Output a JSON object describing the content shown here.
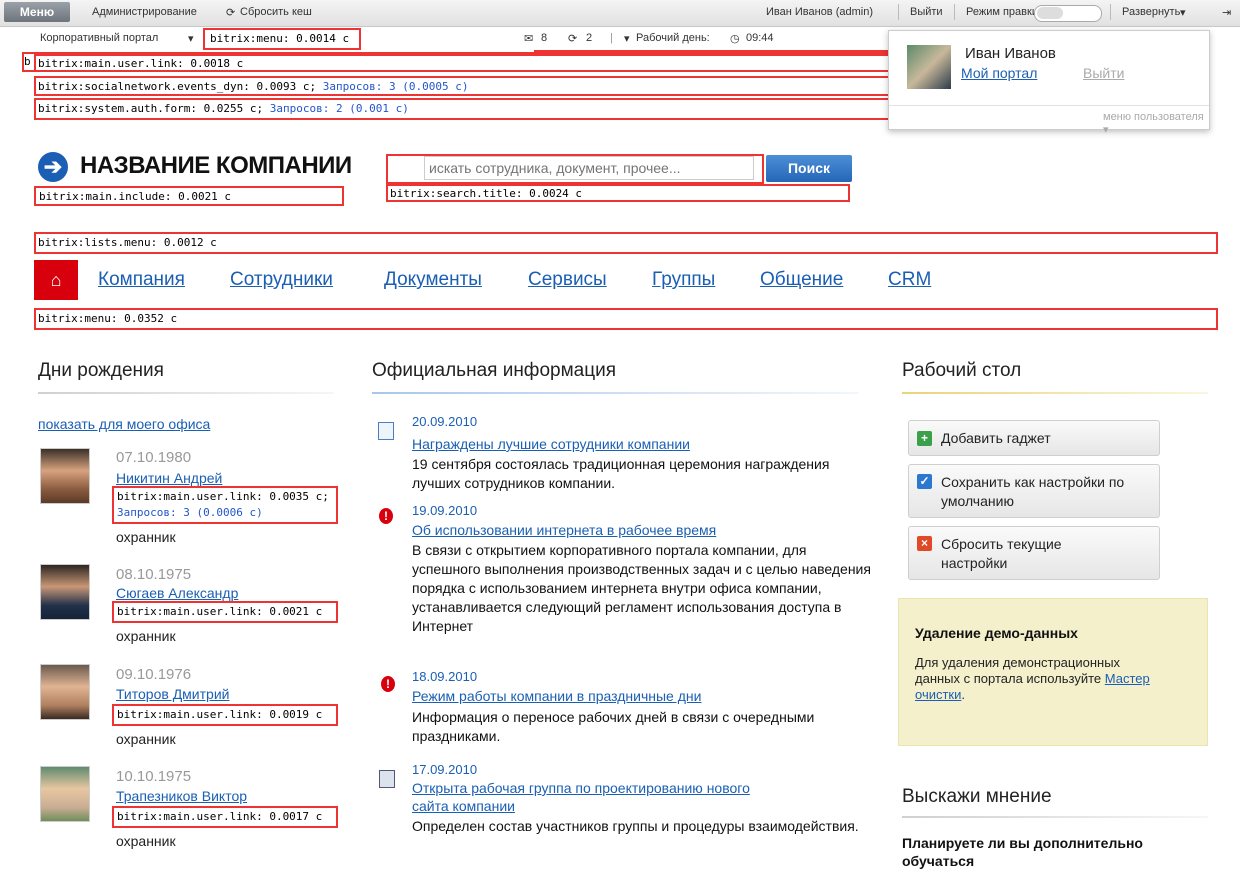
{
  "admin_bar": {
    "menu_button": "Меню",
    "administration": "Администрирование",
    "clear_cache": "Сбросить кеш",
    "user": "Иван Иванов (admin)",
    "logout": "Выйти",
    "edit_mode": "Режим правки",
    "expand": "Развернуть"
  },
  "sub_bar": {
    "portal": "Корпоративный портал",
    "messages_count": "8",
    "updates_count": "2",
    "workday_label": "Рабочий день:",
    "workday_time": "09:44"
  },
  "user_popup": {
    "name": "Иван Иванов",
    "my_portal": "Мой портал",
    "logout": "Выйти",
    "user_menu": "меню пользователя"
  },
  "debug": {
    "menu_top": "bitrix:menu: 0.0014 с",
    "user_link_top_prefix": "b",
    "user_link_top": "bitrix:main.user.link: 0.0018 с",
    "socnet": "bitrix:socialnetwork.events_dyn: 0.0093 с;",
    "socnet_q": "Запросов: 3 (0.0005 с)",
    "auth": "bitrix:system.auth.form: 0.0255 с;",
    "auth_q": "Запросов: 2 (0.001 с)",
    "include": "bitrix:main.include: 0.0021 с",
    "search": "bitrix:search.title: 0.0024 с",
    "lists_menu": "bitrix:lists.menu: 0.0012 с",
    "menu_bottom": "bitrix:menu: 0.0352 с",
    "ul1": "bitrix:main.user.link: 0.0035 с;",
    "ul1_q": "Запросов: 3 (0.0006 с)",
    "ul2": "bitrix:main.user.link: 0.0021 с",
    "ul3": "bitrix:main.user.link: 0.0019 с",
    "ul4": "bitrix:main.user.link: 0.0017 с"
  },
  "company": {
    "name": "НАЗВАНИЕ КОМПАНИИ"
  },
  "search": {
    "placeholder": "искать сотрудника, документ, прочее...",
    "button": "Поиск"
  },
  "nav": [
    "Компания",
    "Сотрудники",
    "Документы",
    "Сервисы",
    "Группы",
    "Общение",
    "CRM"
  ],
  "birthdays": {
    "title": "Дни рождения",
    "show_office": "показать для моего офиса",
    "people": [
      {
        "date": "07.10.1980",
        "name": "Никитин Андрей",
        "job": "охранник"
      },
      {
        "date": "08.10.1975",
        "name": "Сюгаев Александр",
        "job": "охранник"
      },
      {
        "date": "09.10.1976",
        "name": "Титоров Дмитрий",
        "job": "охранник"
      },
      {
        "date": "10.10.1975",
        "name": "Трапезников Виктор",
        "job": "охранник"
      }
    ]
  },
  "news": {
    "title": "Официальная информация",
    "items": [
      {
        "date": "20.09.2010",
        "title": "Награждены лучшие сотрудники компании",
        "body": "19 сентября состоялась традиционная церемония награждения лучших сотрудников компании."
      },
      {
        "date": "19.09.2010",
        "title": "Об использовании интернета в рабочее время",
        "body": "В связи с открытием корпоративного портала компании, для успешного выполнения производственных задач и с целью наведения порядка с использованием интернета внутри офиса компании, устанавливается следующий регламент использования доступа в Интернет"
      },
      {
        "date": "18.09.2010",
        "title": "Режим работы компании в праздничные дни",
        "body": "Информация о переносе рабочих дней в связи с очередными праздниками."
      },
      {
        "date": "17.09.2010",
        "title": "Открыта рабочая группа по проектированию нового",
        "title2": "сайта компании",
        "body": "Определен состав участников группы и процедуры взаимодействия."
      }
    ]
  },
  "desktop": {
    "title": "Рабочий стол",
    "add_gadget": "Добавить гаджет",
    "save_default": "Сохранить как настройки по умолчанию",
    "reset": "Сбросить текущие настройки"
  },
  "demo": {
    "title": "Удаление демо-данных",
    "text": "Для удаления демонстрационных данных с портала используйте",
    "link": "Мастер очистки",
    "after": "."
  },
  "poll": {
    "title": "Выскажи мнение",
    "question": "Планируете ли вы дополнительно обучаться"
  },
  "colors": {
    "accent": "#1a5fb4",
    "debug_border": "#e33333",
    "home_red": "#d9000d"
  }
}
